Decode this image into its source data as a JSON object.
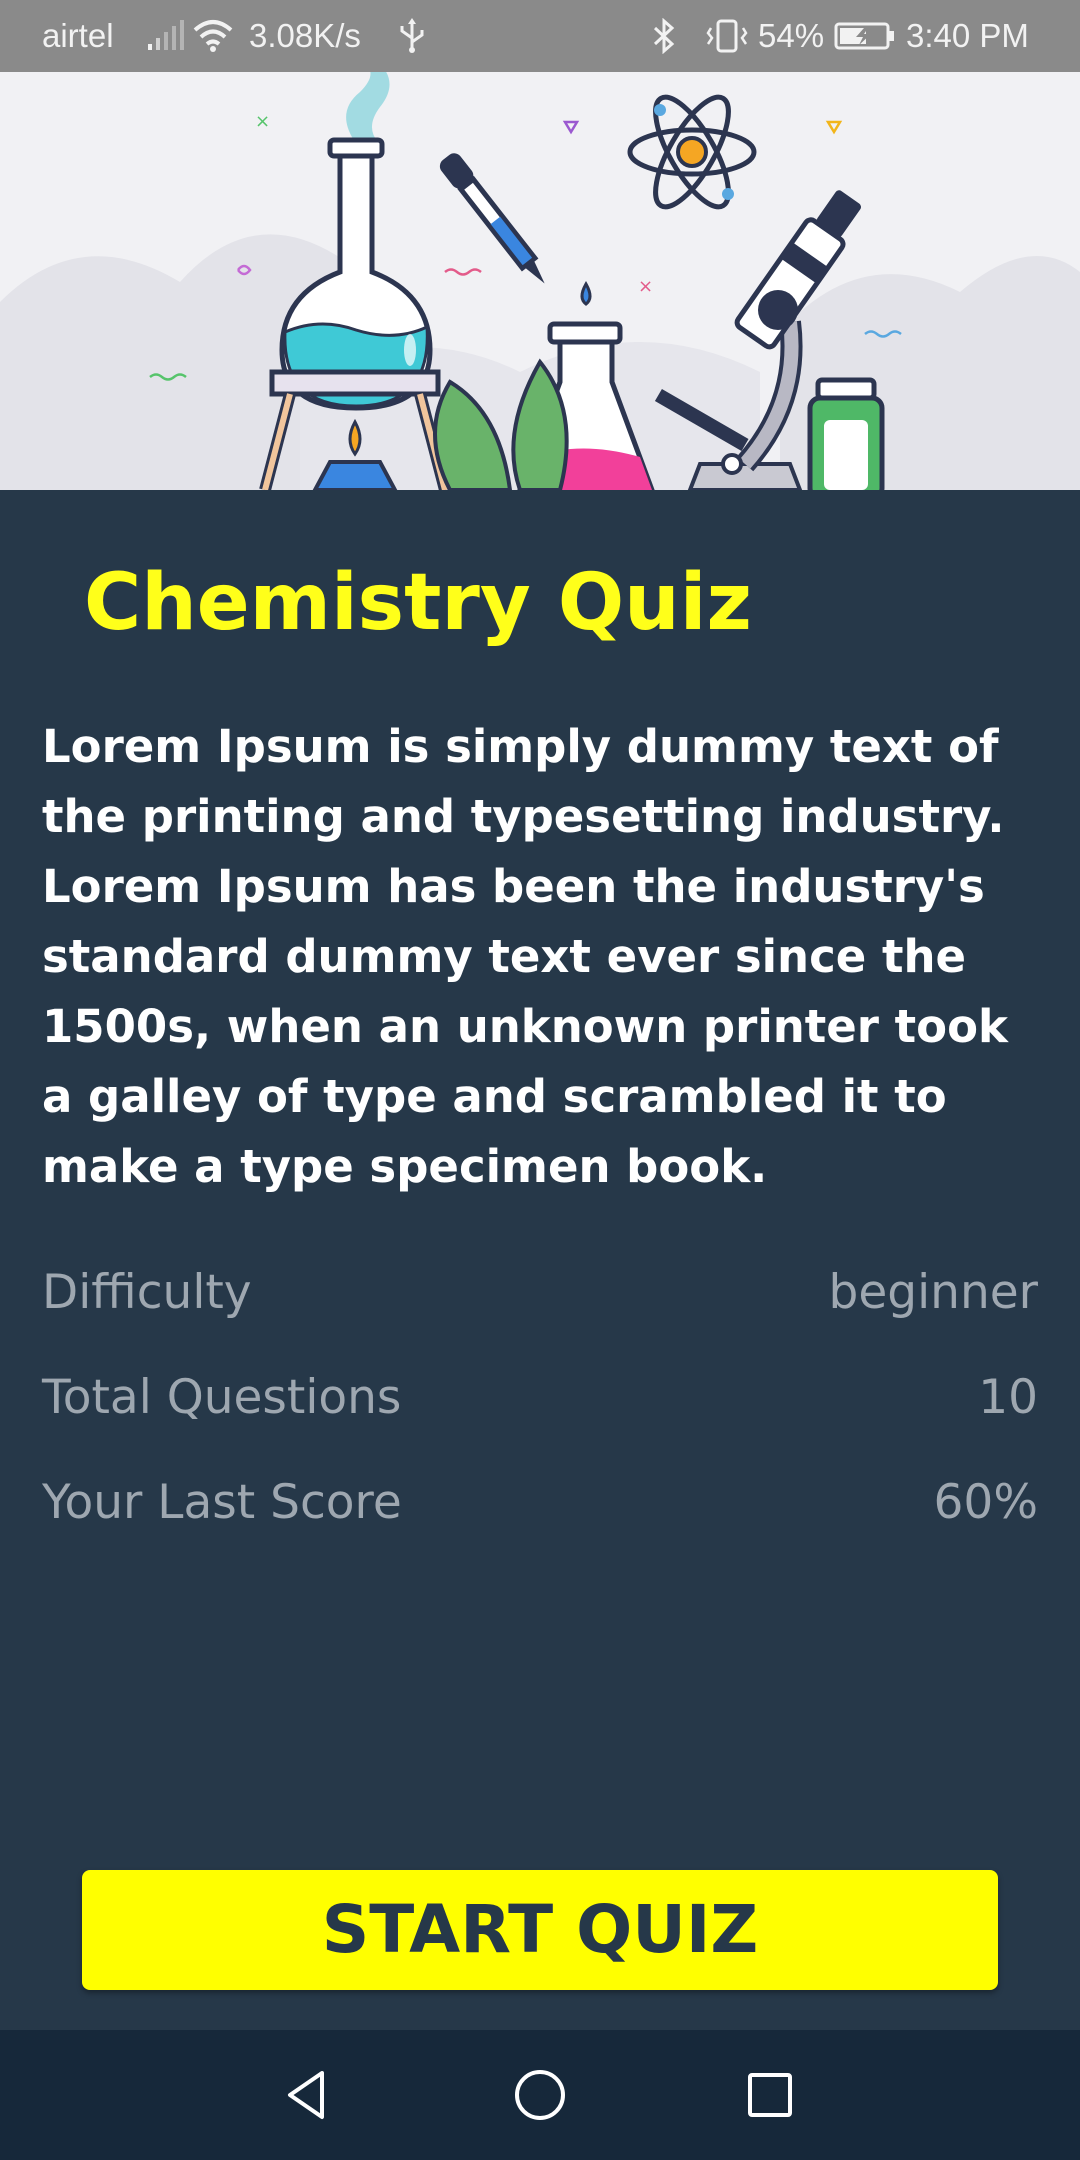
{
  "status_bar": {
    "carrier": "airtel",
    "speed": "3.08K/s",
    "battery_percent": "54%",
    "time": "3:40 PM",
    "icons": [
      "signal-icon",
      "wifi-icon",
      "usb-icon",
      "bluetooth-icon",
      "vibrate-icon",
      "battery-icon"
    ]
  },
  "hero": {
    "illustration": "chemistry-lab-illustration"
  },
  "quiz": {
    "title": "Chemistry Quiz",
    "description": "Lorem Ipsum is simply dummy text of the printing and typesetting industry. Lorem Ipsum has been the industry's standard dummy text ever since the 1500s, when an unknown printer took a galley of type and scrambled it to make a type specimen book.",
    "stats": {
      "difficulty_label": "Difficulty",
      "difficulty_value": "beginner",
      "questions_label": "Total Questions",
      "questions_value": "10",
      "score_label": "Your Last Score",
      "score_value": "60%"
    },
    "start_label": "START QUIZ"
  },
  "nav_bar": {
    "icons": [
      "back-icon",
      "home-icon",
      "recents-icon"
    ]
  },
  "colors": {
    "background": "#263849",
    "accent": "#ffff00",
    "status_bar": "#8a8a8a",
    "nav_bar": "#16283a"
  }
}
